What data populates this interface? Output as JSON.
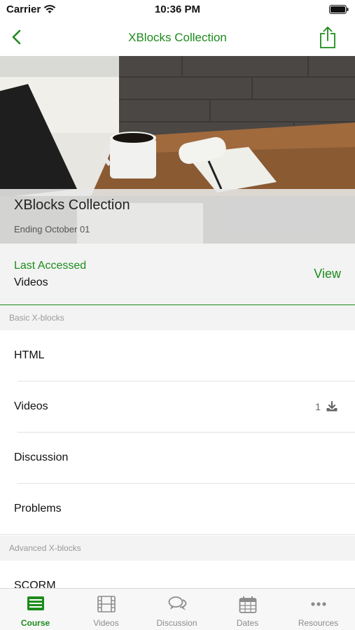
{
  "status": {
    "carrier": "Carrier",
    "time": "10:36 PM"
  },
  "nav": {
    "title": "XBlocks Collection"
  },
  "hero": {
    "course_title": "XBlocks Collection",
    "ending": "Ending October 01"
  },
  "last_accessed": {
    "label": "Last Accessed",
    "value": "Videos",
    "action": "View"
  },
  "sections": [
    {
      "header": "Basic X-blocks",
      "items": [
        "HTML",
        "Videos",
        "Discussion",
        "Problems"
      ]
    },
    {
      "header": "Advanced X-blocks",
      "items": [
        "SCORM"
      ]
    }
  ],
  "videos_download": {
    "count": "1"
  },
  "tabs": [
    {
      "label": "Course",
      "icon": "course-icon",
      "active": true
    },
    {
      "label": "Videos",
      "icon": "film-icon",
      "active": false
    },
    {
      "label": "Discussion",
      "icon": "chat-bubbles-icon",
      "active": false
    },
    {
      "label": "Dates",
      "icon": "calendar-icon",
      "active": false
    },
    {
      "label": "Resources",
      "icon": "more-dots-icon",
      "active": false
    }
  ],
  "colors": {
    "accent": "#1c8c1c",
    "section_bg": "#f3f3f3",
    "muted": "#8c8c8c"
  }
}
